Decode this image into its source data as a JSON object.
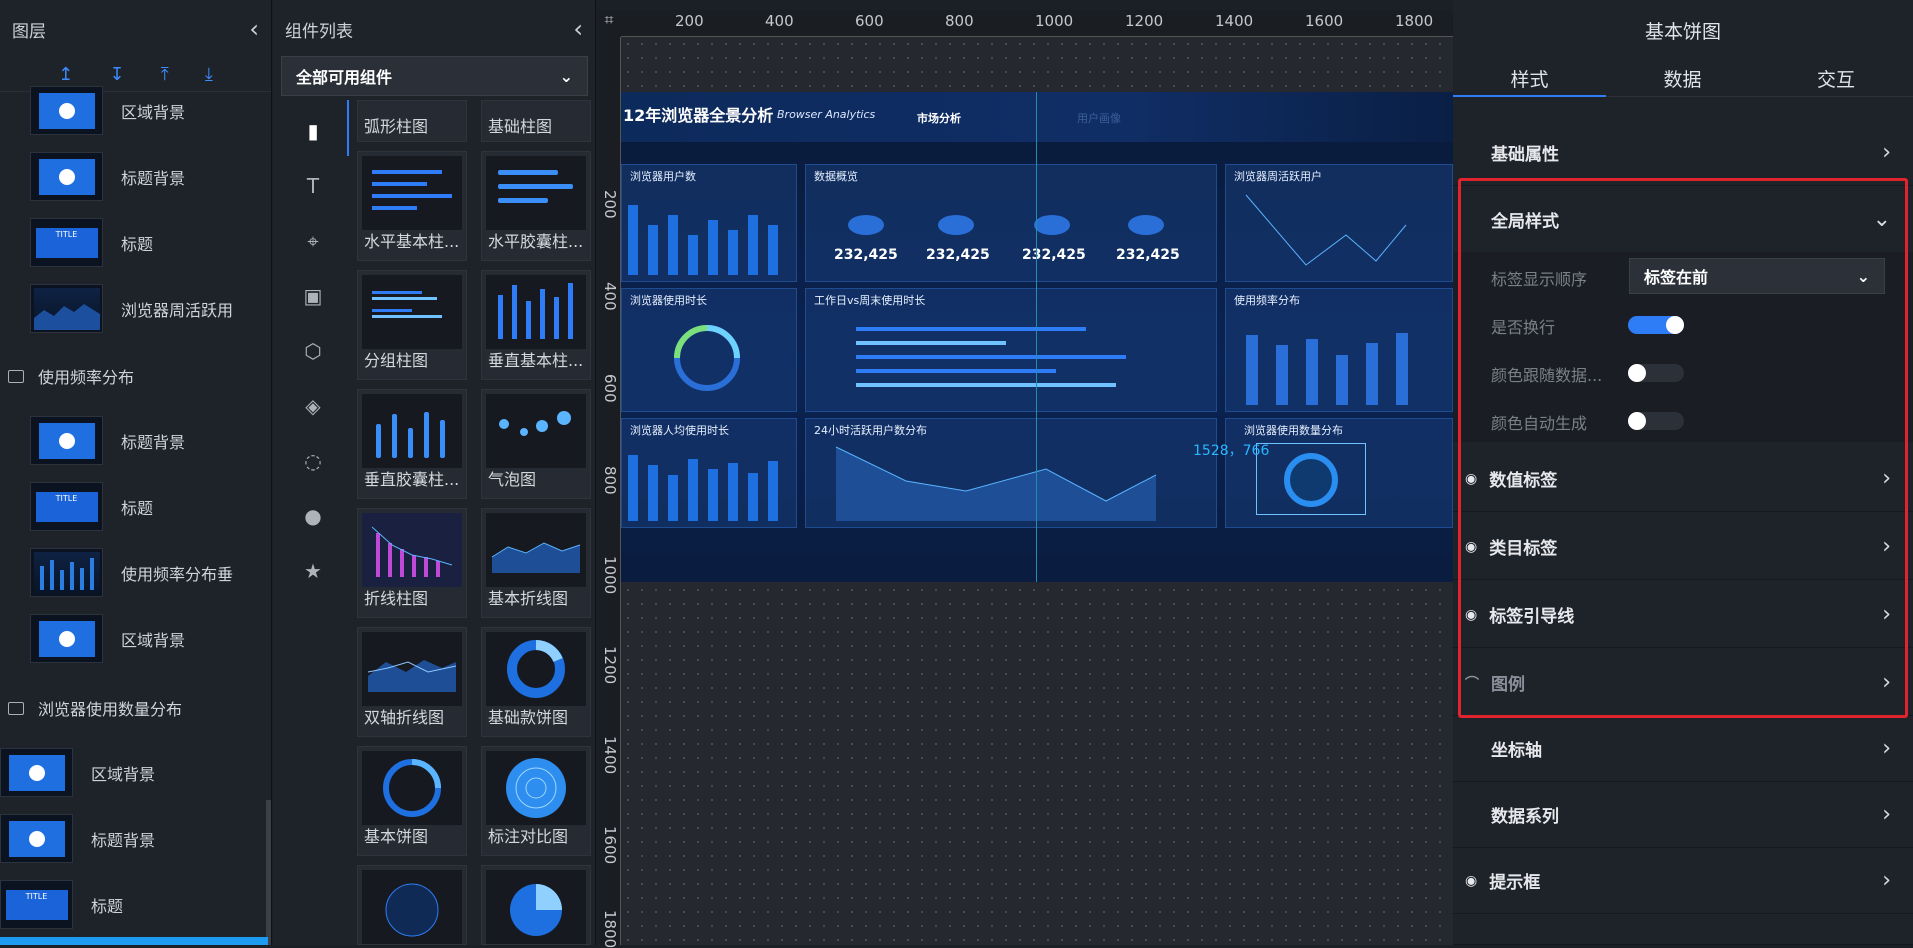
{
  "layers_panel": {
    "title": "图层",
    "tools": [
      "↥",
      "↧",
      "⤒",
      "⤓"
    ],
    "items": [
      {
        "label": "区域背景",
        "thumb": "area"
      },
      {
        "label": "标题背景",
        "thumb": "area"
      },
      {
        "label": "标题",
        "thumb": "title"
      },
      {
        "label": "浏览器周活跃用",
        "thumb": "chart"
      },
      {
        "label": "标题背景",
        "thumb": "area"
      },
      {
        "label": "标题",
        "thumb": "title"
      },
      {
        "label": "使用频率分布垂",
        "thumb": "chart"
      },
      {
        "label": "区域背景",
        "thumb": "area"
      },
      {
        "label": "区域背景",
        "thumb": "area"
      },
      {
        "label": "标题背景",
        "thumb": "area"
      },
      {
        "label": "标题",
        "thumb": "title"
      }
    ],
    "groups": [
      "使用频率分布",
      "浏览器使用数量分布"
    ],
    "thumb_title_text": "TITLE"
  },
  "components_panel": {
    "title": "组件列表",
    "filter": "全部可用组件",
    "categories": [
      "bar-chart-icon",
      "text-icon",
      "map-pin-icon",
      "media-icon",
      "cube-icon",
      "misc-icon",
      "circle-icon",
      "user-icon",
      "star-icon"
    ],
    "cards": [
      "弧形柱图",
      "基础柱图",
      "水平基本柱...",
      "水平胶囊柱...",
      "分组柱图",
      "垂直基本柱...",
      "垂直胶囊柱...",
      "气泡图",
      "折线柱图",
      "基本折线图",
      "双轴折线图",
      "基础款饼图",
      "基本饼图",
      "标注对比图",
      "",
      ""
    ]
  },
  "canvas": {
    "ruler_top": [
      "200",
      "400",
      "600",
      "800",
      "1000",
      "1200",
      "1400",
      "1600",
      "1800"
    ],
    "ruler_left": [
      "200",
      "400",
      "600",
      "800",
      "1000",
      "1200",
      "1400",
      "1600",
      "1800"
    ],
    "dashboard": {
      "title": "12年浏览器全景分析",
      "subtitle": "Browser Analytics",
      "nav": [
        "市场分析",
        "用户画像"
      ],
      "panels": [
        "浏览器用户数",
        "数据概览",
        "浏览器周活跃用户",
        "浏览器使用时长",
        "工作日vs周末使用时长",
        "使用频率分布",
        "浏览器人均使用时长",
        "24小时活跃用户数分布",
        "浏览器使用数量分布"
      ],
      "kpis": [
        "232,425",
        "232,425",
        "232,425",
        "232,425"
      ],
      "coord": "1528，766"
    }
  },
  "props_panel": {
    "title": "基本饼图",
    "tabs": [
      "样式",
      "数据",
      "交互"
    ],
    "sections": {
      "basic": "基础属性",
      "global": "全局样式",
      "value_label": "数值标签",
      "category_label": "类目标签",
      "guide_line": "标签引导线",
      "legend": "图例",
      "axis": "坐标轴",
      "series": "数据系列",
      "tooltip": "提示框"
    },
    "global_fields": [
      {
        "label": "标签显示顺序",
        "value": "标签在前"
      },
      {
        "label": "是否换行",
        "on": true
      },
      {
        "label": "颜色跟随数据...",
        "on": false
      },
      {
        "label": "颜色自动生成",
        "on": false
      }
    ],
    "highlight_color": "#e0242e",
    "accent": "#2e7cf6"
  }
}
